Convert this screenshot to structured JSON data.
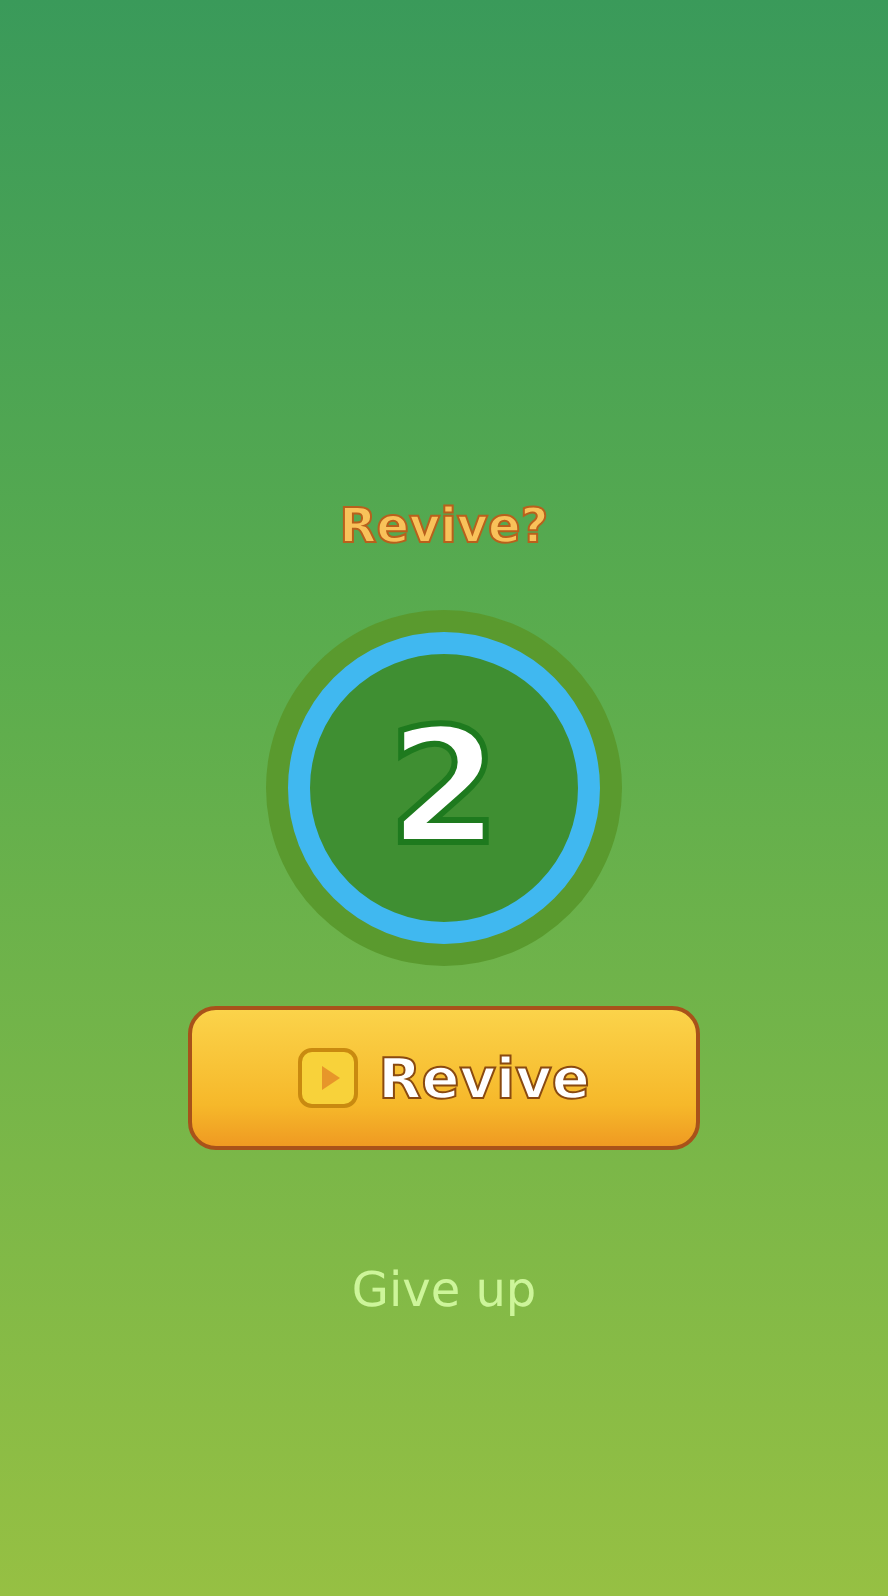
{
  "dialog": {
    "title": "Revive?",
    "countdown": "2",
    "revive_button": "Revive",
    "give_up_link": "Give up"
  }
}
